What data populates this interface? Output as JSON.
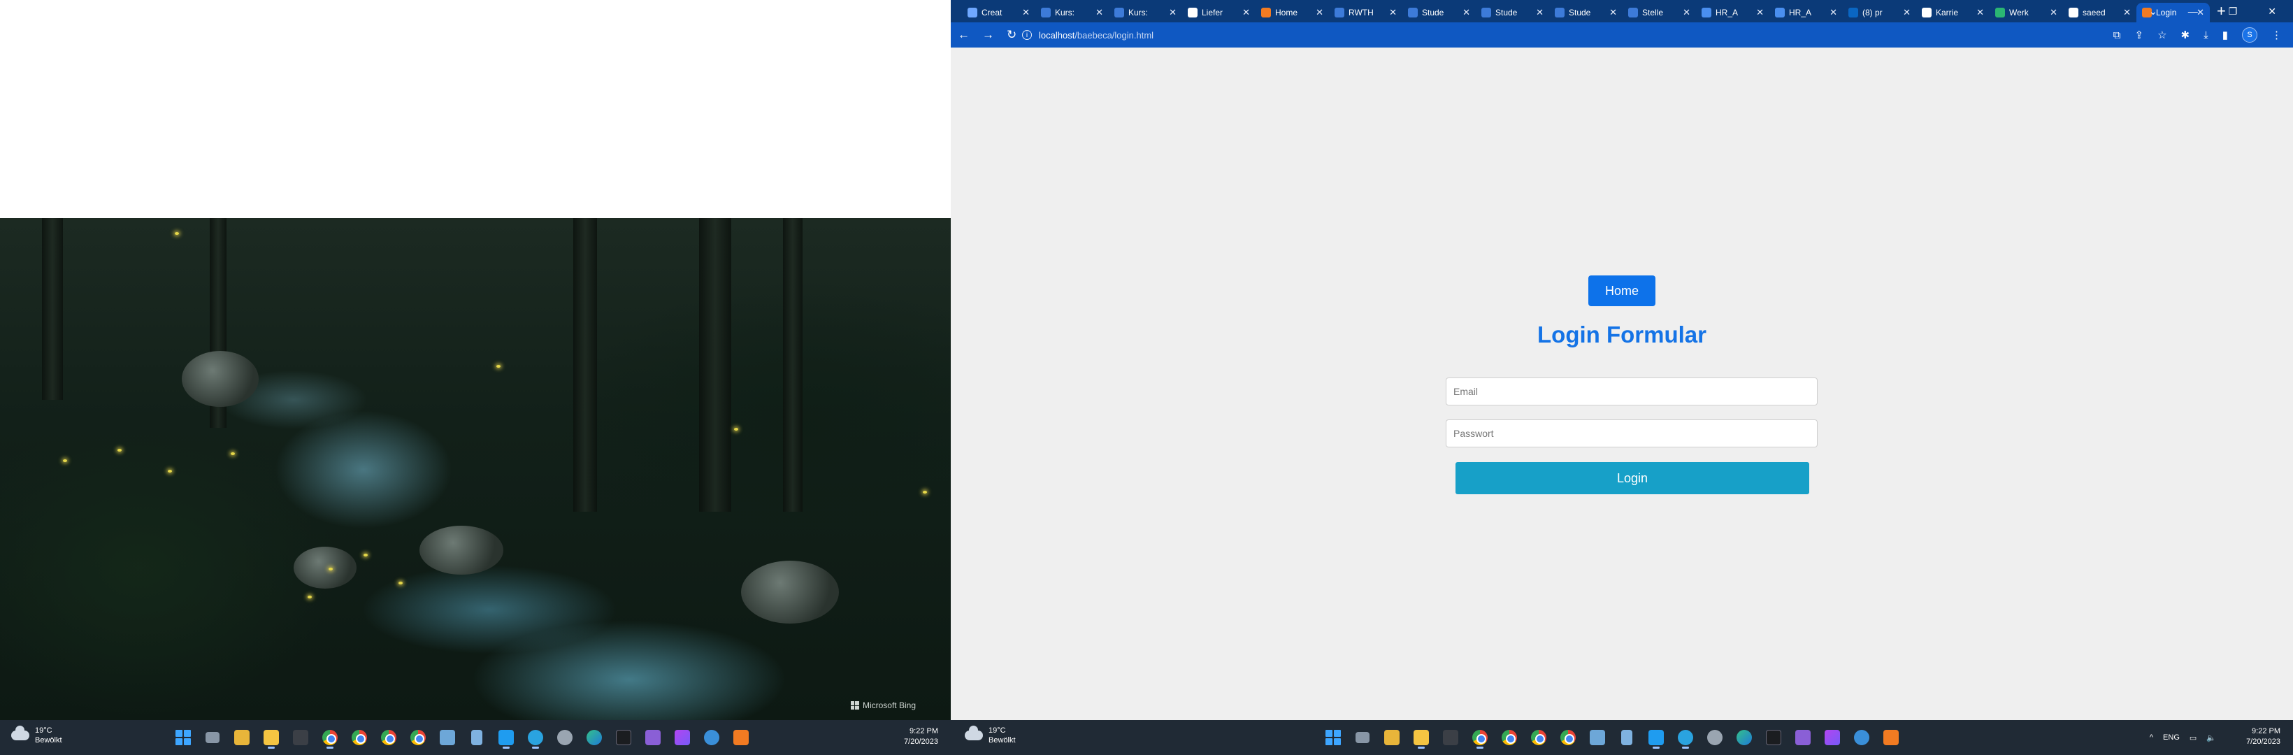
{
  "left_screen": {
    "wallpaper_credit": "Microsoft Bing",
    "taskbar": {
      "weather_temp": "19°C",
      "weather_desc": "Bewölkt",
      "time": "9:22 PM",
      "date": "7/20/2023"
    }
  },
  "browser": {
    "tabs": [
      {
        "title": "Creat",
        "icon": "cloud-icon",
        "color": "#6fa8ff"
      },
      {
        "title": "Kurs:",
        "icon": "moodle-icon",
        "color": "#3d7bd9"
      },
      {
        "title": "Kurs:",
        "icon": "moodle-icon",
        "color": "#3d7bd9"
      },
      {
        "title": "Liefer",
        "icon": "shop-icon",
        "color": "#ffffff"
      },
      {
        "title": "Home",
        "icon": "xampp-icon",
        "color": "#f27b22"
      },
      {
        "title": "RWTH",
        "icon": "moodle-icon",
        "color": "#3d7bd9"
      },
      {
        "title": "Stude",
        "icon": "moodle-icon",
        "color": "#3d7bd9"
      },
      {
        "title": "Stude",
        "icon": "moodle-icon",
        "color": "#3d7bd9"
      },
      {
        "title": "Stude",
        "icon": "moodle-icon",
        "color": "#3d7bd9"
      },
      {
        "title": "Stelle",
        "icon": "moodle-icon",
        "color": "#3d7bd9"
      },
      {
        "title": "HR_A",
        "icon": "hr-icon",
        "color": "#4a8ff0"
      },
      {
        "title": "HR_A",
        "icon": "hr-icon",
        "color": "#4a8ff0"
      },
      {
        "title": "(8) pr",
        "icon": "linkedin-icon",
        "color": "#0a66c2"
      },
      {
        "title": "Karrie",
        "icon": "karriere-icon",
        "color": "#ffffff"
      },
      {
        "title": "Werk",
        "icon": "shield-icon",
        "color": "#2bb673"
      },
      {
        "title": "saeed",
        "icon": "github-icon",
        "color": "#ffffff"
      },
      {
        "title": "Login",
        "icon": "xampp-icon",
        "color": "#f27b22",
        "active": true
      }
    ],
    "address": {
      "host": "localhost",
      "path": "/baebeca/login.html"
    },
    "profile_initial": "S"
  },
  "page": {
    "home_button": "Home",
    "title": "Login Formular",
    "email_placeholder": "Email",
    "password_placeholder": "Passwort",
    "login_button": "Login"
  },
  "right_screen": {
    "taskbar": {
      "weather_temp": "19°C",
      "weather_desc": "Bewölkt",
      "language": "ENG",
      "time": "9:22 PM",
      "date": "7/20/2023"
    }
  }
}
